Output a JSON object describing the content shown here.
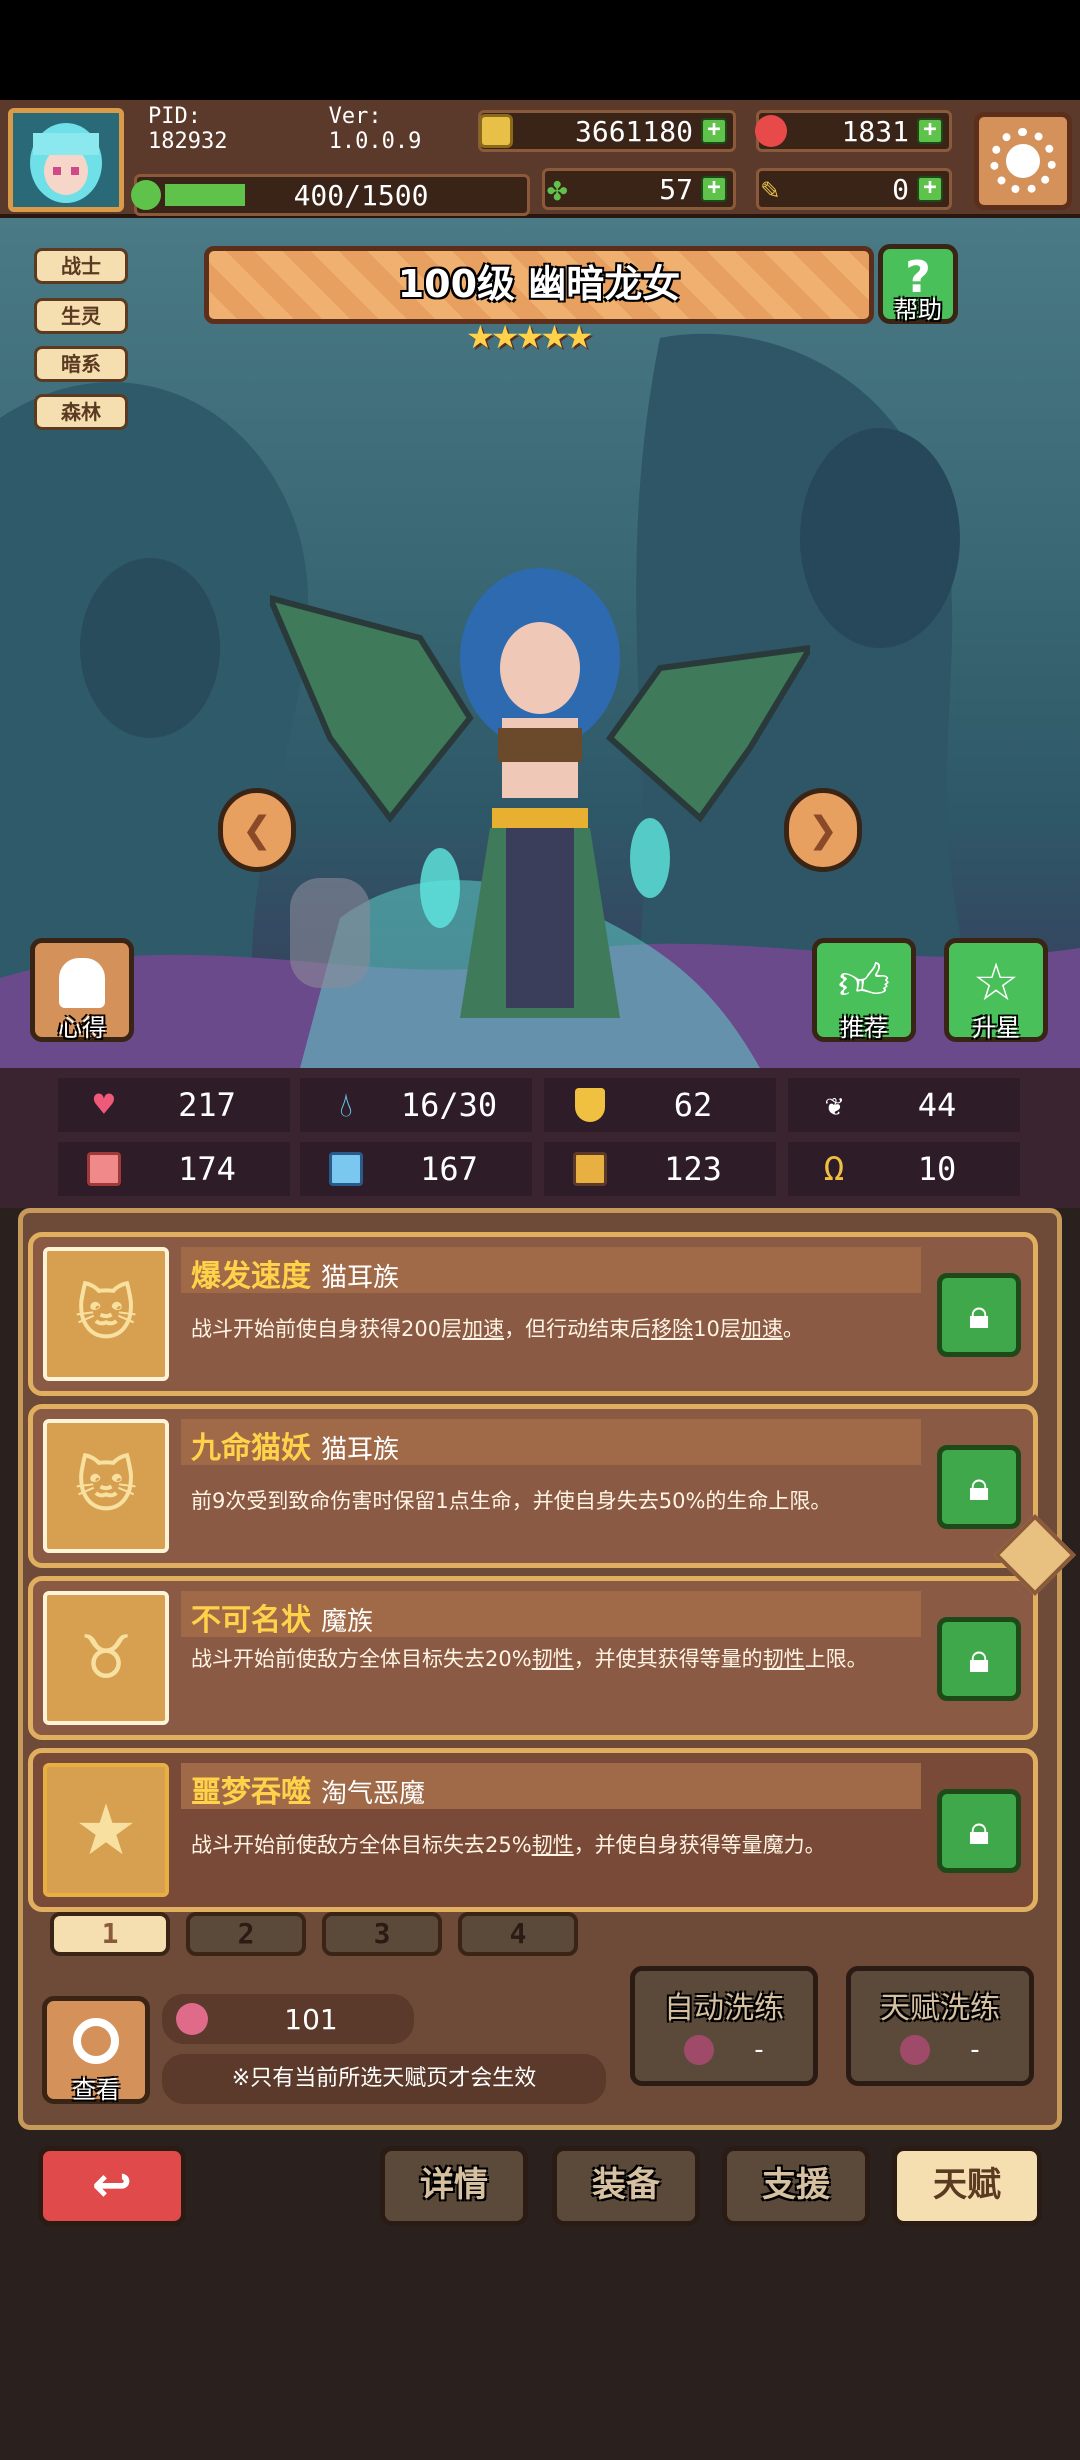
{
  "header": {
    "pid": "PID: 182932",
    "version": "Ver: 1.0.0.9",
    "gold": "3661180",
    "gems": "1831",
    "exp": "400/1500",
    "clover": "57",
    "token": "0"
  },
  "hero": {
    "title": "100级 幽暗龙女",
    "stars": 5,
    "help_label": "帮助",
    "tags": [
      "战士",
      "生灵",
      "暗系",
      "森林"
    ],
    "left_button": "心得",
    "recommend_button": "推荐",
    "upstar_button": "升星"
  },
  "stats": {
    "hp": "217",
    "mana": "16/30",
    "armor": "62",
    "speed": "44",
    "attack": "174",
    "magic": "167",
    "level_stat": "123",
    "luck": "10"
  },
  "talents": [
    {
      "name": "爆发速度",
      "race": "猫耳族",
      "desc_parts": [
        "战斗开始前使自身获得200层",
        "加速",
        "，但行动结束后",
        "移除",
        "10层",
        "加速",
        "。"
      ]
    },
    {
      "name": "九命猫妖",
      "race": "猫耳族",
      "desc_parts": [
        "前9次受到致命伤害时保留1点生命，并使自身失去50%的生命上限。"
      ]
    },
    {
      "name": "不可名状",
      "race": "魔族",
      "desc_parts": [
        "战斗开始前使敌方全体目标失去20%",
        "韧性",
        "，并使其获得等量的",
        "韧性",
        "上限。"
      ]
    },
    {
      "name": "噩梦吞噬",
      "race": "淘气恶魔",
      "desc_parts": [
        "战斗开始前使敌方全体目标失去25%",
        "韧性",
        "，并使自身获得等量魔力。"
      ]
    }
  ],
  "pages": [
    "1",
    "2",
    "3",
    "4"
  ],
  "bottom_panel": {
    "view_label": "查看",
    "seed_count": "101",
    "notice": "※只有当前所选天赋页才会生效",
    "auto_reroll": "自动洗练",
    "auto_cost": "-",
    "talent_reroll": "天赋洗练",
    "talent_cost": "-"
  },
  "nav": {
    "details": "详情",
    "equip": "装备",
    "support": "支援",
    "talent": "天赋"
  },
  "colors": {
    "accent_gold": "#ffd24a",
    "lock_green": "#3fa84a",
    "back_red": "#e04a4a",
    "active_tab": "#f5dfb0"
  }
}
